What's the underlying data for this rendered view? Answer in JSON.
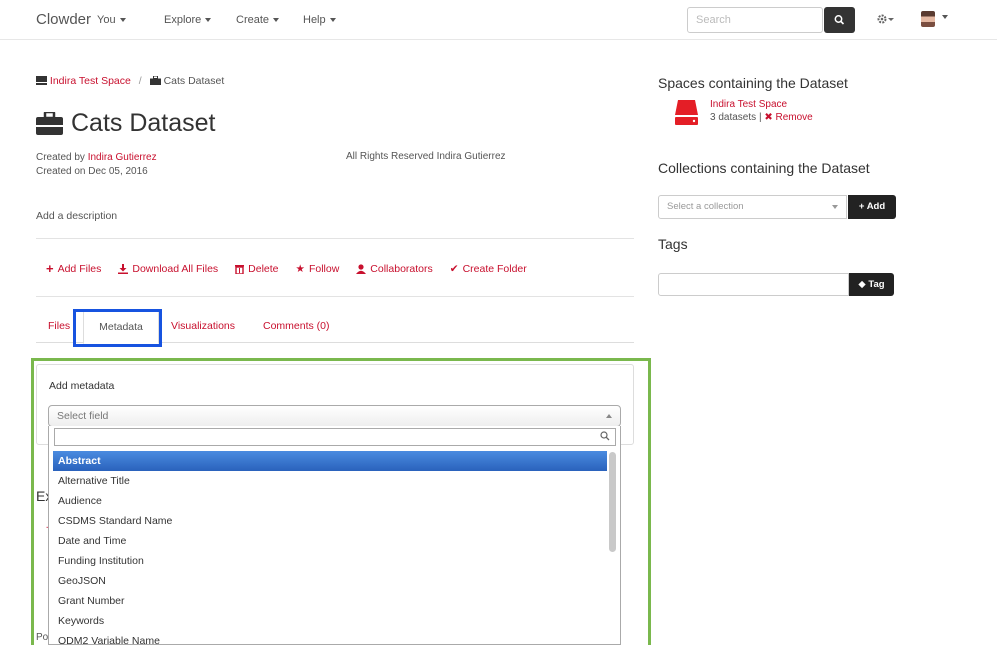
{
  "nav": {
    "brand": "Clowder",
    "items": [
      "You",
      "Explore",
      "Create",
      "Help"
    ],
    "search_placeholder": "Search"
  },
  "breadcrumb": {
    "space": "Indira Test Space",
    "separator": "/",
    "dataset": "Cats Dataset"
  },
  "dataset": {
    "title": "Cats Dataset",
    "created_by_label": "Created by",
    "created_by": "Indira Gutierrez",
    "created_on": "Created on Dec 05, 2016",
    "rights": "All Rights Reserved Indira Gutierrez",
    "add_description": "Add a description"
  },
  "actions": {
    "add_files": "Add Files",
    "download": "Download All Files",
    "delete": "Delete",
    "follow": "Follow",
    "collaborators": "Collaborators",
    "create_folder": "Create Folder"
  },
  "tabs": {
    "files": "Files",
    "metadata": "Metadata",
    "visualizations": "Visualizations",
    "comments": "Comments (0)"
  },
  "metadata_panel": {
    "title": "Add metadata",
    "select_placeholder": "Select field",
    "options": [
      "Abstract",
      "Alternative Title",
      "Audience",
      "CSDMS Standard Name",
      "Date and Time",
      "Funding Institution",
      "GeoJSON",
      "Grant Number",
      "Keywords",
      "ODM2 Variable Name"
    ],
    "highlighted": "Abstract"
  },
  "hidden_fragments": {
    "heading": "Ex",
    "sub": "Po"
  },
  "sidebar": {
    "spaces_heading": "Spaces containing the Dataset",
    "space_name": "Indira Test Space",
    "space_count": "3 datasets",
    "space_sep": "|",
    "remove": "Remove",
    "collections_heading": "Collections containing the Dataset",
    "collection_placeholder": "Select a collection",
    "add_button": "Add",
    "tags_heading": "Tags",
    "tag_button": "Tag"
  },
  "colors": {
    "accent": "#c8102e",
    "highlight": "#3875d7",
    "blue_annotation": "#1753e0",
    "green_annotation": "#7ab84d"
  }
}
